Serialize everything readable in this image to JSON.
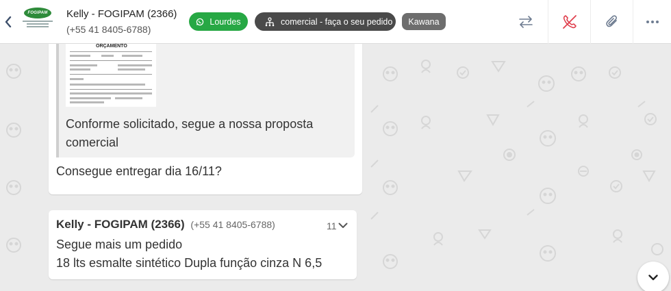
{
  "header": {
    "contact_name": "Kelly - FOGIPAM (2366)",
    "contact_phone": "(+55 41 8405-6788)",
    "avatar_brand": "FOGIPAM",
    "tags": [
      {
        "label": "Lourdes",
        "icon": "whatsapp-icon",
        "color": "#27a844"
      },
      {
        "label": "comercial - faça o seu pedido",
        "icon": "sitemap-icon",
        "color": "#4a4a4a"
      },
      {
        "label": "Kawana",
        "color": "#6d6d6d"
      }
    ],
    "actions": [
      "transfer-icon",
      "end-call-icon",
      "attachment-icon",
      "more-icon"
    ],
    "accent_red": "#e0404e"
  },
  "messages": [
    {
      "quoted": {
        "document_title": "ORÇAMENTO",
        "text": "Conforme solicitado, segue a nossa proposta comercial"
      },
      "text": "Consegue entregar dia 16/11?"
    },
    {
      "sender": "Kelly - FOGIPAM (2366)",
      "sender_phone": "(+55 41 8405-6788)",
      "time": "11",
      "lines": [
        "Segue mais um pedido",
        "18 lts esmalte sintético Dupla função cinza N 6,5"
      ]
    }
  ],
  "scroll_down_icon": "chevron-down-icon"
}
